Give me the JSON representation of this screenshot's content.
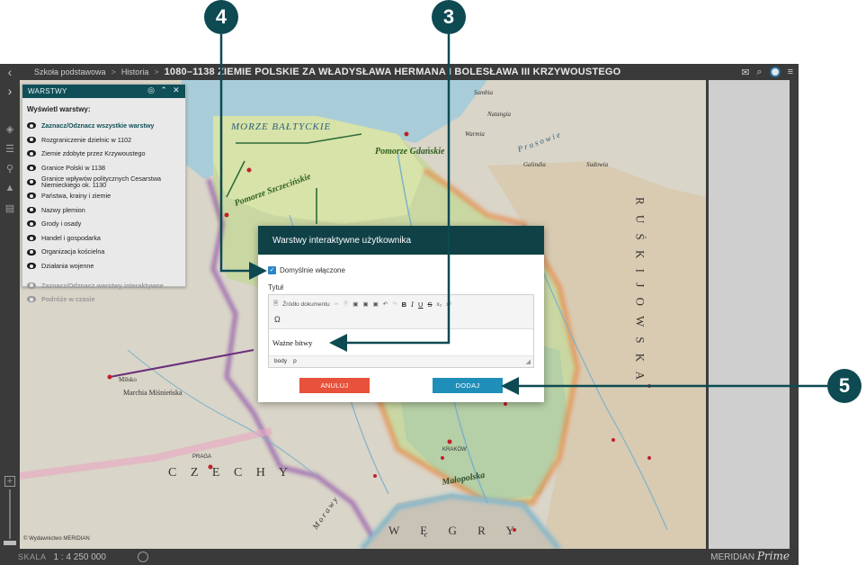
{
  "breadcrumb": {
    "items": [
      "Szkoła podstawowa",
      "Historia"
    ],
    "separator": ">",
    "title": "1080–1138 ZIEMIE POLSKIE ZA WŁADYSŁAWA HERMANA I BOLESŁAWA III KRZYWOUSTEGO"
  },
  "layers_panel": {
    "header": "WARSTWY",
    "subtitle": "Wyświetl warstwy:",
    "items": [
      "Zaznacz/Odznacz wszystkie warstwy",
      "Rozgraniczenie dzielnic w 1102",
      "Ziemie zdobyte przez Krzywoustego",
      "Granice Polski w 1138",
      "Granice wpływów politycznych Cesarstwa Niemieckiego ok. 1130",
      "Państwa, krainy i ziemie",
      "Nazwy plemion",
      "Grody i osady",
      "Handel i gospodarka",
      "Organizacja kościelna",
      "Działania wojenne"
    ],
    "muted_items": [
      "Zaznacz/Odznacz warstwy interaktywne",
      "Podróże w czasie"
    ]
  },
  "dialog": {
    "title": "Warstwy interaktywne użytkownika",
    "default_label": "Domyślnie włączone",
    "default_checked": true,
    "field_label": "Tytuł",
    "source_button": "Źródło dokumentu",
    "content": "Ważne bitwy",
    "path": [
      "body",
      "p"
    ],
    "cancel": "ANULUJ",
    "add": "DODAJ"
  },
  "callouts": [
    "4",
    "3",
    "5"
  ],
  "map_labels": {
    "sea": "MORZE BAŁTYCKIE",
    "pomorze_sz": "Pomorze Szczecińskie",
    "pomorze_gd": "Pomorze Gdańskie",
    "marchia": "Marchia Miśnieńska",
    "czechy": "C Z E C H Y",
    "ruska": "R U Ś  K I J O W S K A",
    "wegry": "W Ę G R Y",
    "malopolska": "Małopolska",
    "milsko": "Milsko",
    "prusowie": "P r u s o w i e",
    "praga": "PRAGA",
    "krakow": "KRAKÓW",
    "morawy": "M o r a w y",
    "sambia": "Sambia",
    "natangia": "Natangia",
    "warmia": "Warmia",
    "galindia": "Galindia",
    "sudowia": "Sudowia"
  },
  "footer": {
    "scale_label": "SKALA",
    "scale_value": "1 : 4 250 000",
    "copyright": "© Wydawnictwo MERIDIAN",
    "brand": "MERIDIAN",
    "brand_suffix": "Prime"
  },
  "colors": {
    "header_teal": "#0f4147",
    "cancel_red": "#e8513b",
    "add_blue": "#1f8fb9",
    "callout_teal": "#0d4a52",
    "checkbox_blue": "#2a86c8"
  }
}
